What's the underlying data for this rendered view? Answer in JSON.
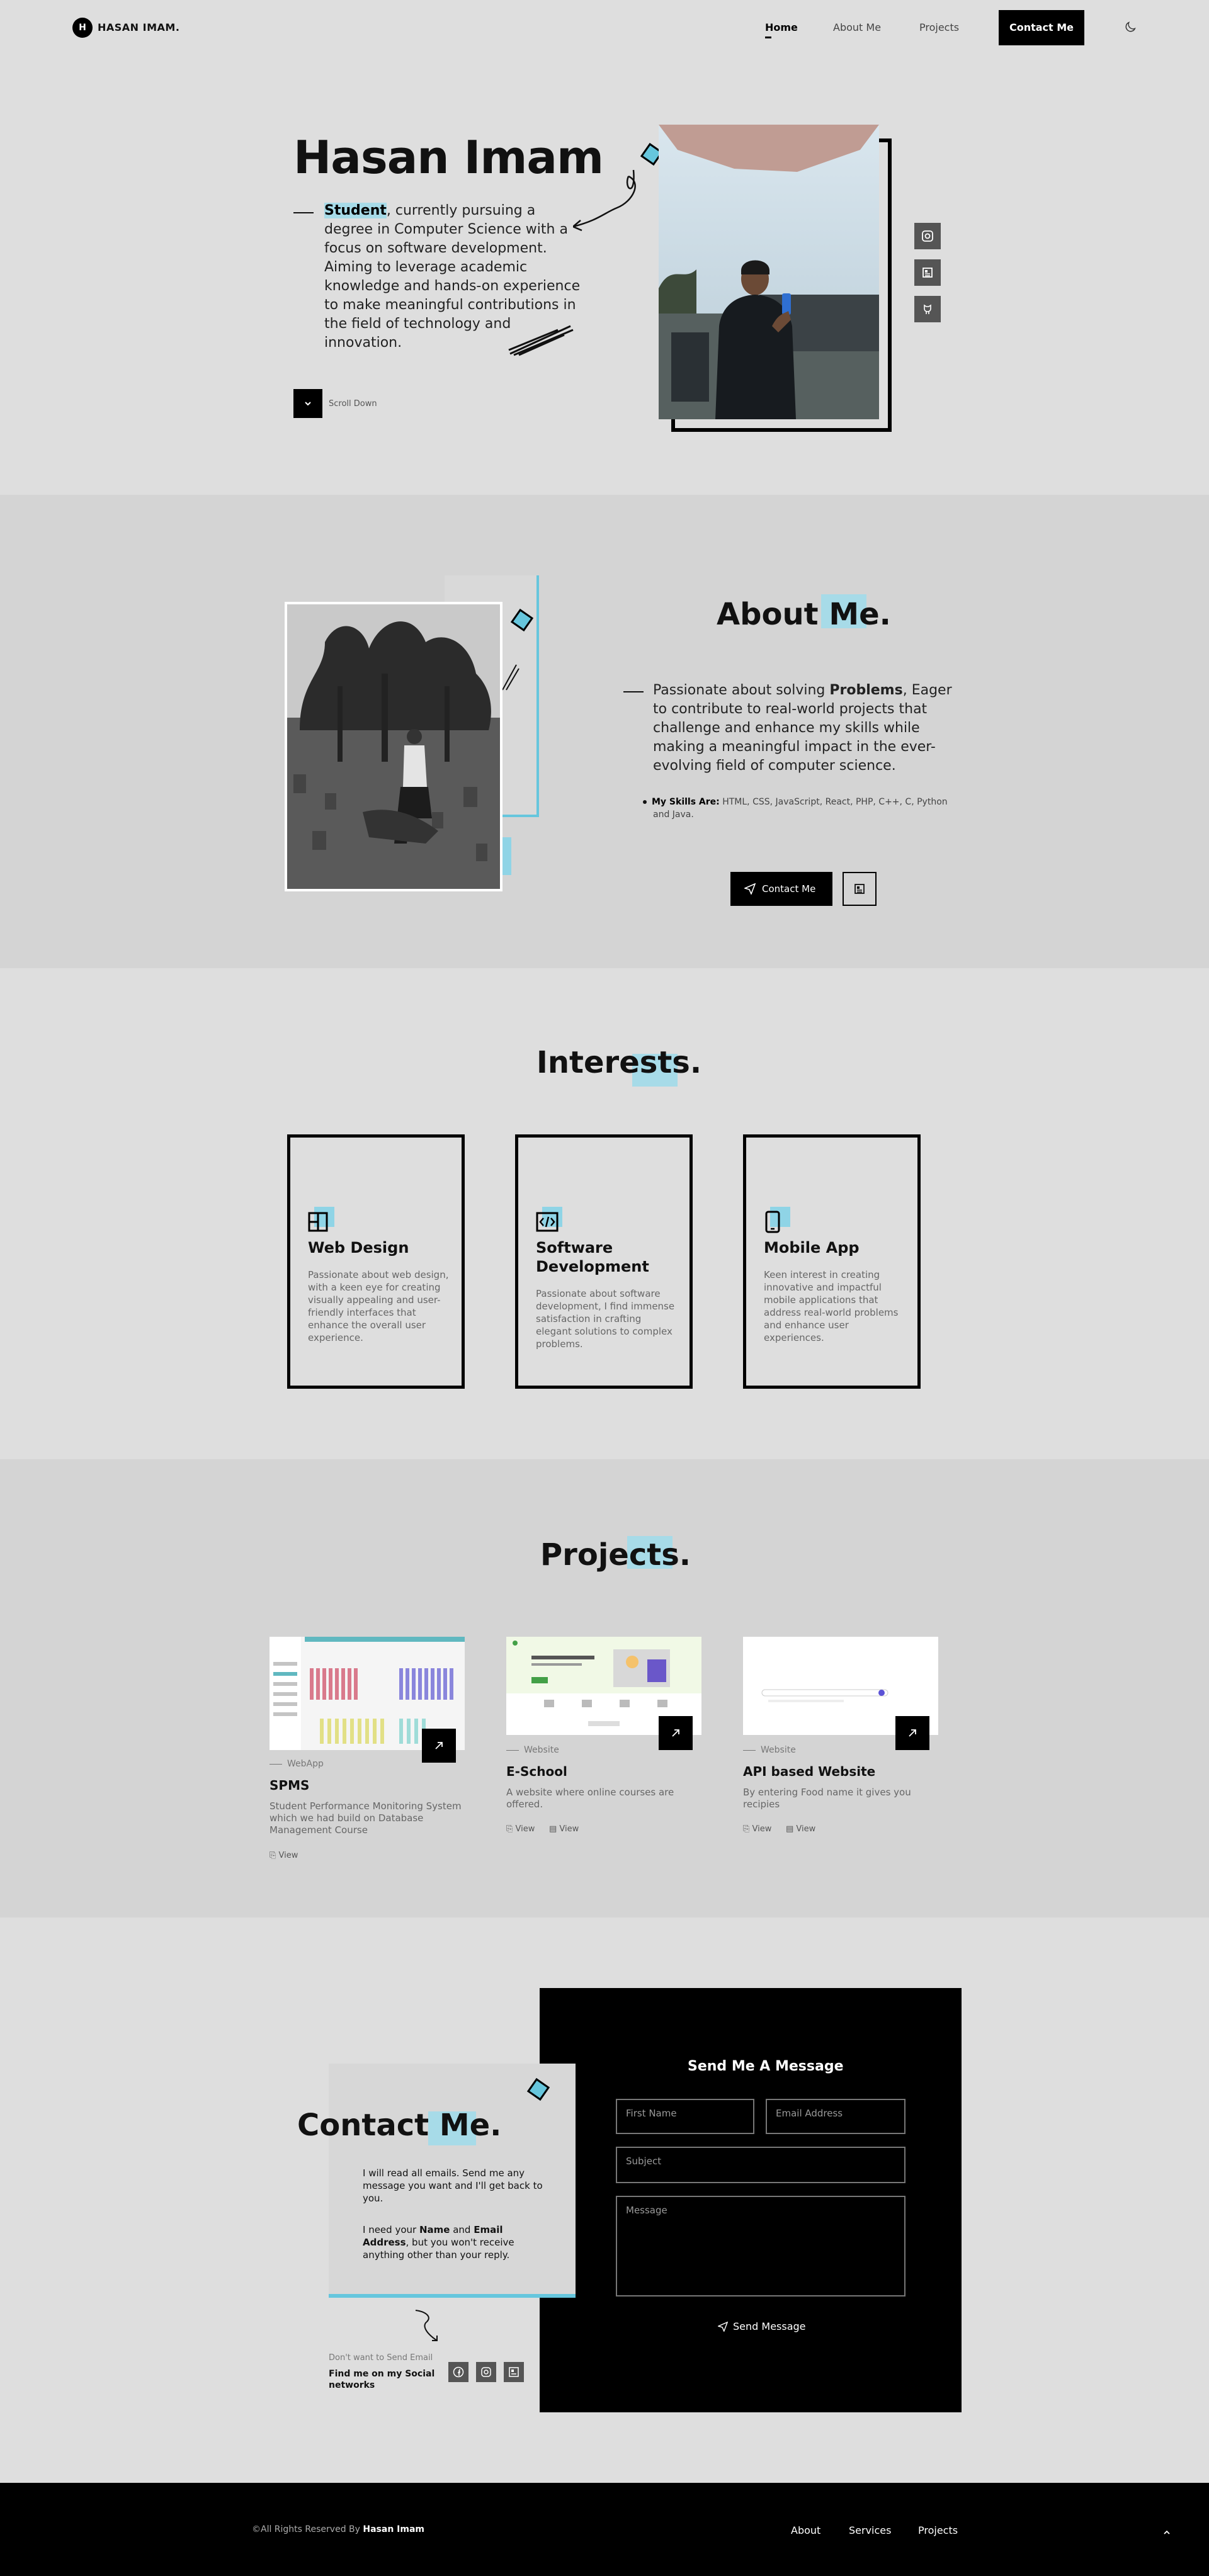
{
  "nav": {
    "logo_initial": "H",
    "logo_text": "HASAN IMAM.",
    "links": [
      "Home",
      "About Me",
      "Projects"
    ],
    "cta": "Contact Me"
  },
  "hero": {
    "title": "Hasan Imam",
    "text_bold": "Student",
    "text_rest": ", currently pursuing a degree in Computer Science with a focus on software development. Aiming to leverage academic knowledge and hands-on experience to make meaningful contributions in the field of technology and innovation.",
    "scroll_label": "Scroll Down"
  },
  "about": {
    "title": "About Me.",
    "text_pre": "Passionate about solving ",
    "text_bold": "Problems",
    "text_post": ", Eager to contribute to real-world projects that challenge and enhance my skills while making a meaningful impact in the ever-evolving field of computer science.",
    "skills_label": "My Skills Are:",
    "skills_list": " HTML, CSS, JavaScript, React, PHP, C++, C, Python and Java.",
    "contact_button": "Contact Me"
  },
  "interests": {
    "title": "Interests.",
    "cards": [
      {
        "title": "Web Design",
        "desc": "Passionate about web design, with a keen eye for creating visually appealing and user-friendly interfaces that enhance the overall user experience."
      },
      {
        "title": "Software Development",
        "desc": "Passionate about software development, I find immense satisfaction in crafting elegant solutions to complex problems."
      },
      {
        "title": "Mobile App",
        "desc": "Keen interest in creating innovative and impactful mobile applications that address real-world problems and enhance user experiences."
      }
    ]
  },
  "projects": {
    "title": "Projects.",
    "items": [
      {
        "tag": "WebApp",
        "name": "SPMS",
        "desc": "Student Performance Monitoring System which we had build on Database Management Course",
        "links": [
          "View"
        ]
      },
      {
        "tag": "Website",
        "name": "E-School",
        "desc": "A website where online courses are offered.",
        "links": [
          "View",
          "View"
        ]
      },
      {
        "tag": "Website",
        "name": "API based Website",
        "desc": "By entering Food name it gives you recipies",
        "links": [
          "View",
          "View"
        ]
      }
    ]
  },
  "contact": {
    "title": "Contact Me.",
    "p1": "I will read all emails. Send me any message you want and I'll get back to you.",
    "p2_pre": "I need your ",
    "p2_name": "Name",
    "p2_and": " and ",
    "p2_email": "Email Address",
    "p2_post": ", but you won't receive anything other than your reply.",
    "form_title": "Send Me A Message",
    "placeholders": {
      "first": "First Name",
      "email": "Email Address",
      "subject": "Subject",
      "message": "Message"
    },
    "send": "Send Message",
    "no_email": "Don't want to Send Email",
    "social_label": "Find me on my Social networks"
  },
  "footer": {
    "copy_pre": "©All Rights Reserved By ",
    "copy_name": "Hasan Imam",
    "links": [
      "About",
      "Services",
      "Projects"
    ]
  },
  "colors": {
    "accent": "#a7dbe8",
    "accent_strong": "#66c6dd",
    "dark": "#000000",
    "bg": "#dedede"
  }
}
